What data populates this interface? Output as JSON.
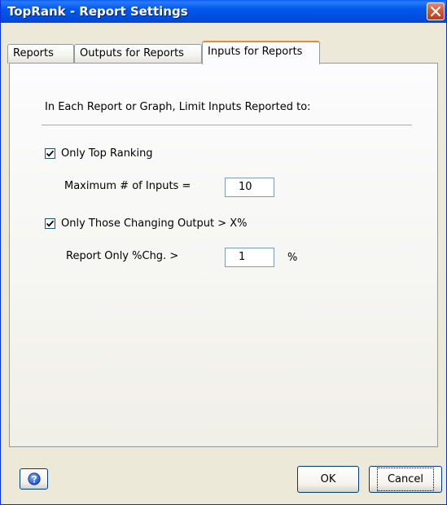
{
  "window": {
    "title": "TopRank - Report Settings"
  },
  "tabs": [
    {
      "label": "Reports",
      "active": false
    },
    {
      "label": "Outputs for Reports",
      "active": false
    },
    {
      "label": "Inputs for Reports",
      "active": true
    }
  ],
  "panel": {
    "heading": "In Each Report or Graph, Limit Inputs Reported to:",
    "top_ranking": {
      "checkbox_label": "Only Top Ranking",
      "checked": true,
      "max_inputs_label": "Maximum # of Inputs =",
      "max_inputs_value": "10"
    },
    "changing_output": {
      "checkbox_label": "Only Those Changing Output > X%",
      "checked": true,
      "pct_label": "Report Only %Chg. >",
      "pct_value": "1",
      "pct_unit": "%"
    }
  },
  "footer": {
    "help_icon": "question-help-icon",
    "ok_label": "OK",
    "cancel_label": "Cancel"
  },
  "colors": {
    "titlebar": "#0058ee",
    "close": "#d65a3c",
    "active_tab_accent": "#e68b2c",
    "dialog_bg": "#ece9d8"
  }
}
